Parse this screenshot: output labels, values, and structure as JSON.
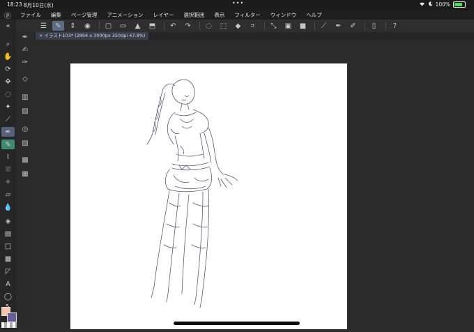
{
  "status": {
    "time": "18:23",
    "date": "8月10日(水)",
    "dots": "•••",
    "battery": "100%"
  },
  "menu": {
    "items": [
      "ファイル",
      "編集",
      "ページ管理",
      "アニメーション",
      "レイヤー",
      "選択範囲",
      "表示",
      "フィルター",
      "ウィンドウ",
      "ヘルプ"
    ]
  },
  "tab": {
    "title": "イラスト103* (2894 x 3000px 350dpi 47.8%)"
  },
  "colors": {
    "main": "#f5c4a8",
    "sub": "#6a5d93",
    "accent": "#5d6a84"
  }
}
